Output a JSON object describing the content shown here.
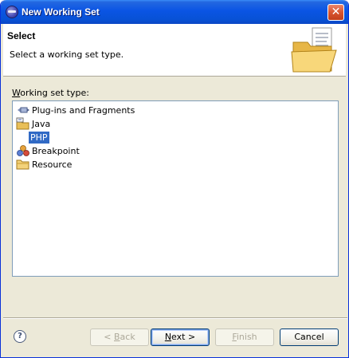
{
  "window": {
    "title": "New Working Set"
  },
  "header": {
    "title": "Select",
    "description": "Select a working set type."
  },
  "working_set": {
    "label_first": "W",
    "label_rest": "orking set type:",
    "items": [
      {
        "label": "Plug-ins and Fragments",
        "icon": "plugin-icon",
        "selected": false
      },
      {
        "label": "Java",
        "icon": "java-project-icon",
        "selected": false
      },
      {
        "label": "PHP",
        "icon": "",
        "selected": true
      },
      {
        "label": "Breakpoint",
        "icon": "breakpoint-icon",
        "selected": false
      },
      {
        "label": "Resource",
        "icon": "folder-icon",
        "selected": false
      }
    ]
  },
  "footer": {
    "help_glyph": "?",
    "back_pre": "< ",
    "back_u": "B",
    "back_post": "ack",
    "next_u": "N",
    "next_post": "ext >",
    "finish_u": "F",
    "finish_post": "inish",
    "cancel_label": "Cancel"
  },
  "colors": {
    "titlebar": "#0a54e4",
    "selection": "#316ac5",
    "dialog_bg": "#ece9d8"
  }
}
